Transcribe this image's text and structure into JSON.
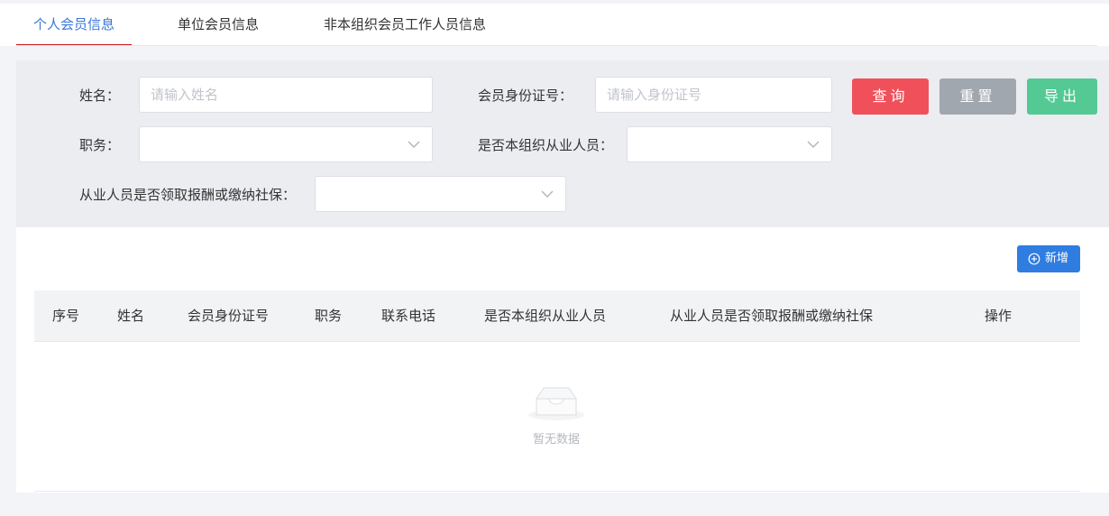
{
  "tabs": [
    {
      "label": "个人会员信息",
      "active": true
    },
    {
      "label": "单位会员信息",
      "active": false
    },
    {
      "label": "非本组织会员工作人员信息",
      "active": false
    }
  ],
  "filter": {
    "name_label": "姓名：",
    "name_placeholder": "请输入姓名",
    "id_label": "会员身份证号：",
    "id_placeholder": "请输入身份证号",
    "position_label": "职务：",
    "is_staff_label": "是否本组织从业人员：",
    "social_label": "从业人员是否领取报酬或缴纳社保："
  },
  "buttons": {
    "query": "查询",
    "reset": "重置",
    "export": "导出",
    "add": "新增"
  },
  "table": {
    "headers": [
      "序号",
      "姓名",
      "会员身份证号",
      "职务",
      "联系电话",
      "是否本组织从业人员",
      "从业人员是否领取报酬或缴纳社保",
      "操作"
    ],
    "empty_text": "暂无数据"
  },
  "colors": {
    "accent": "#3a77d9",
    "tab_underline": "#c8161d",
    "query": "#f0505a",
    "reset": "#a1a7af",
    "export": "#54c994",
    "add": "#2f7de1"
  }
}
